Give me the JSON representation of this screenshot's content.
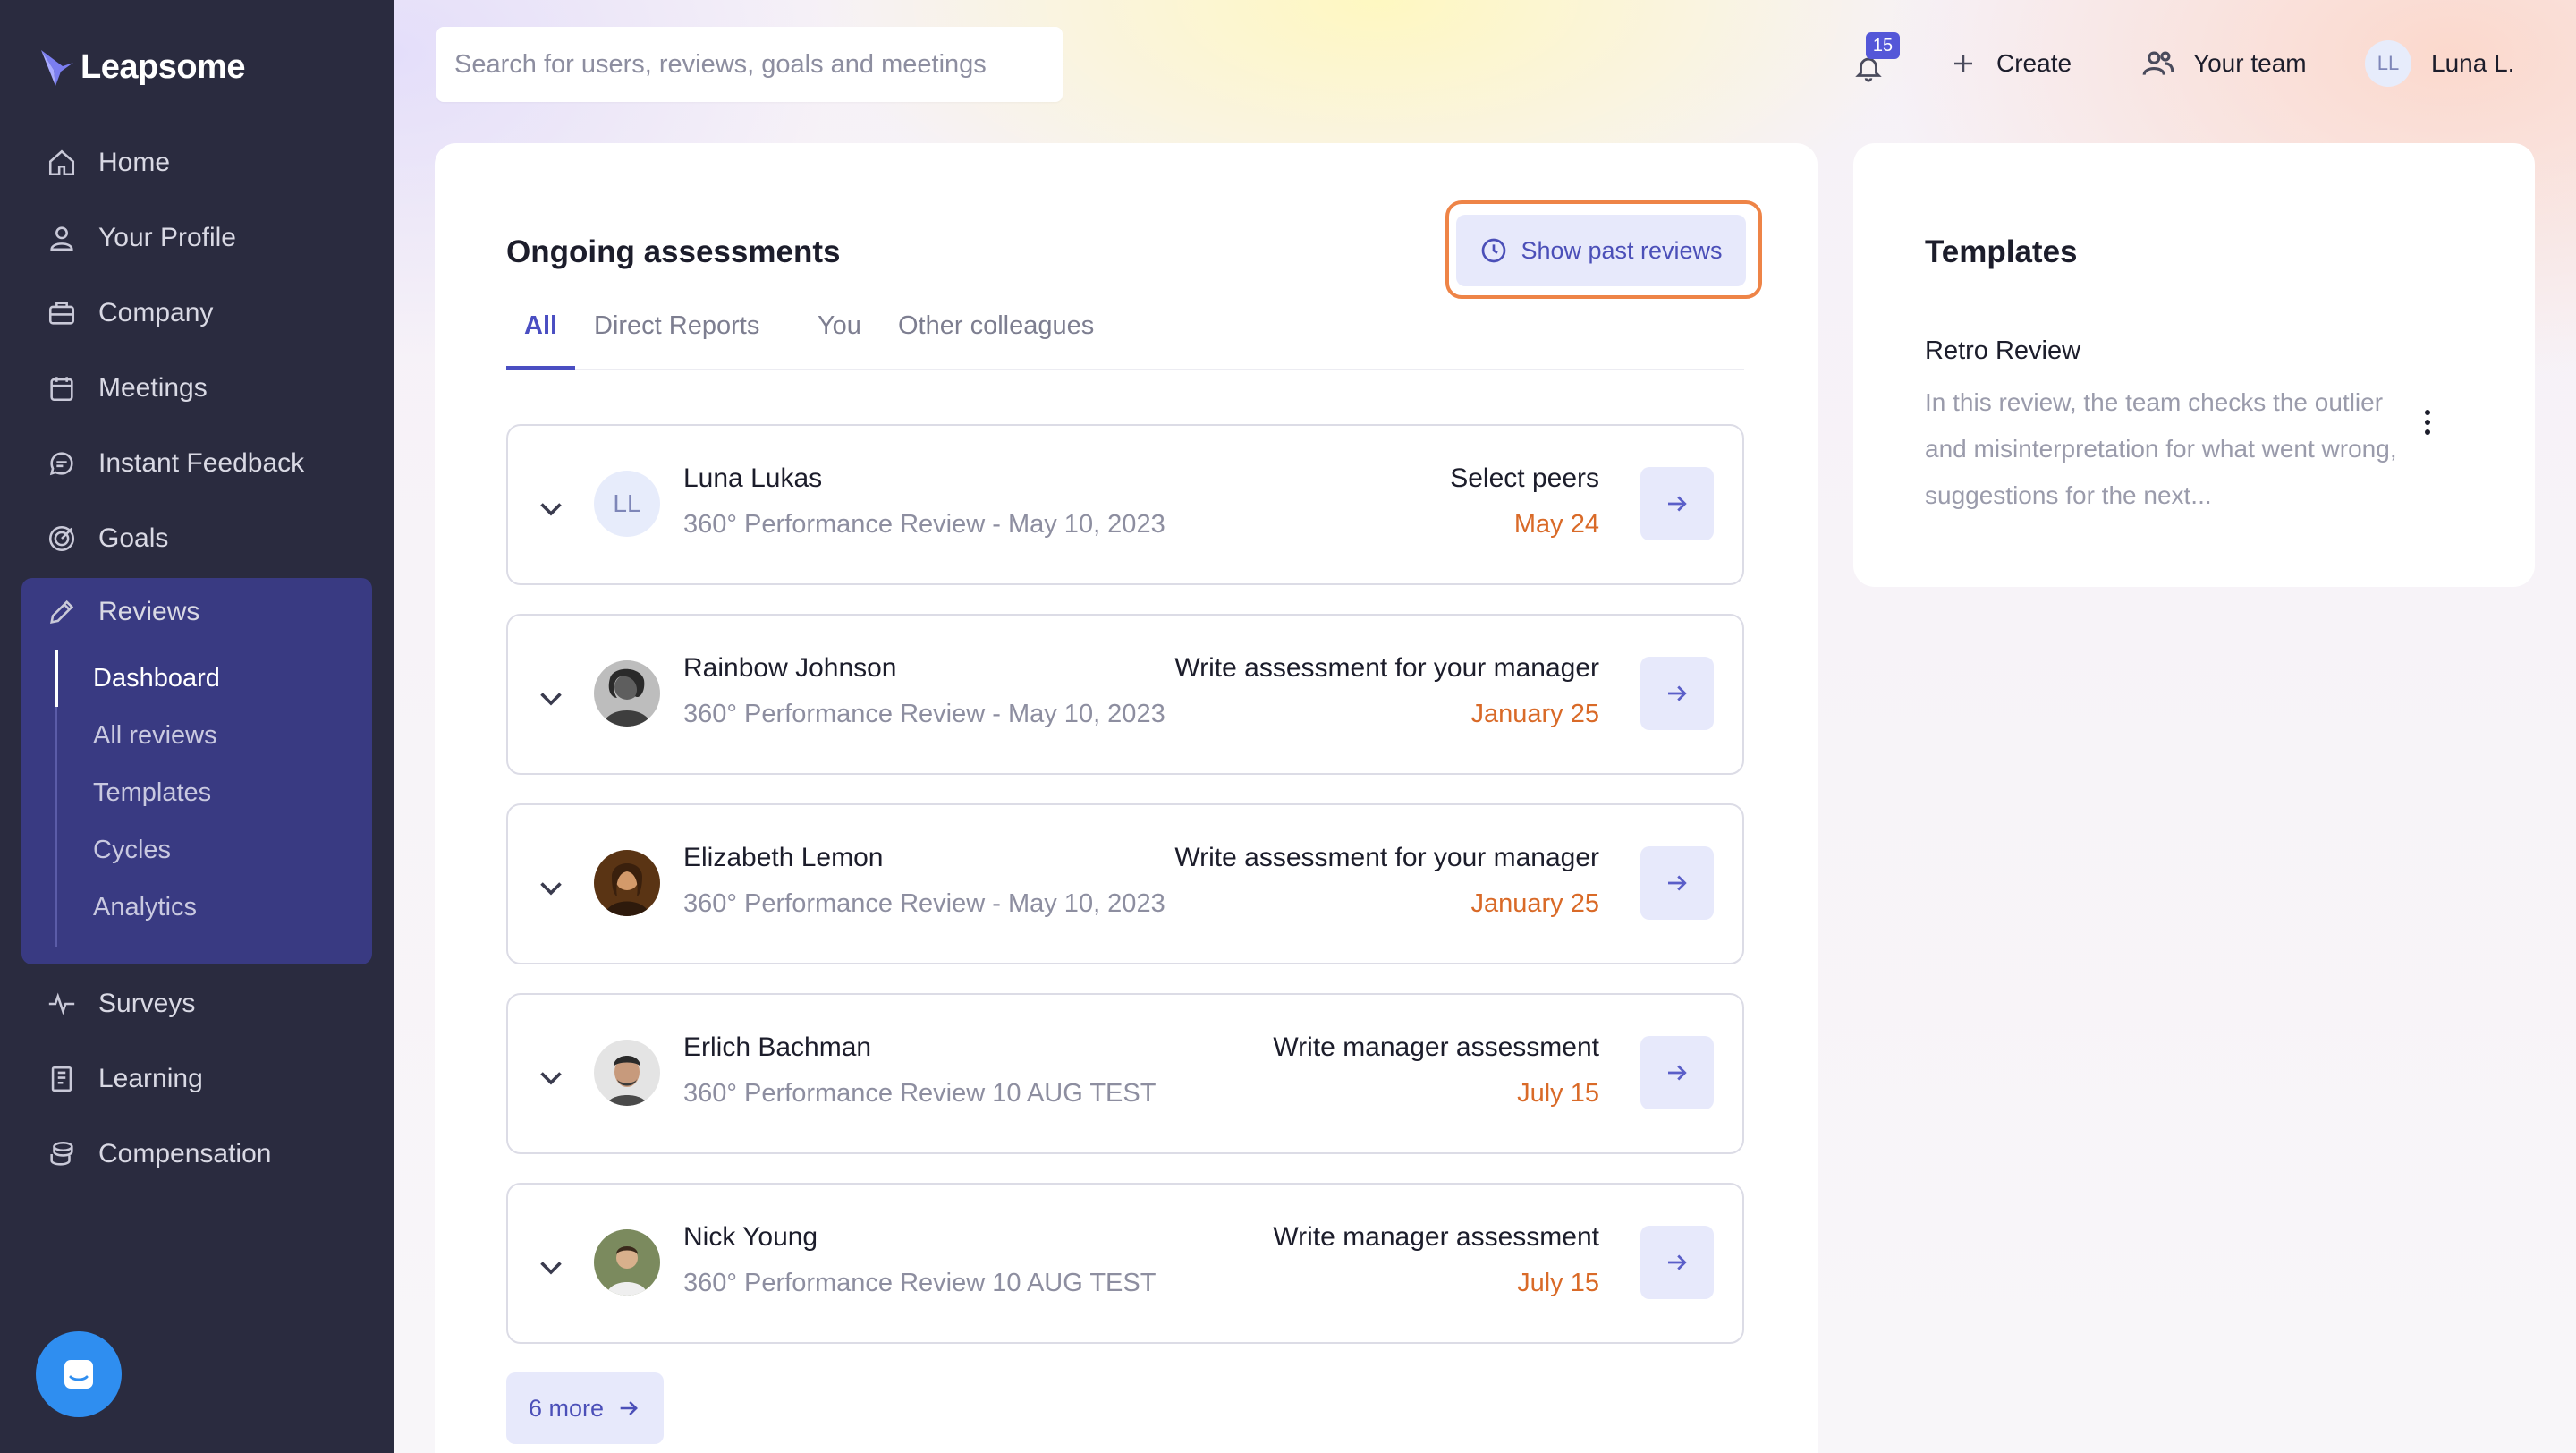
{
  "app": {
    "logo": "Leapsome"
  },
  "sidebar": {
    "items": [
      {
        "label": "Home",
        "icon": "home-icon"
      },
      {
        "label": "Your Profile",
        "icon": "user-icon"
      },
      {
        "label": "Company",
        "icon": "briefcase-icon"
      },
      {
        "label": "Meetings",
        "icon": "calendar-icon"
      },
      {
        "label": "Instant Feedback",
        "icon": "chat-icon"
      },
      {
        "label": "Goals",
        "icon": "target-icon"
      },
      {
        "label": "Reviews",
        "icon": "pencil-icon"
      },
      {
        "label": "Surveys",
        "icon": "pulse-icon"
      },
      {
        "label": "Learning",
        "icon": "book-icon"
      },
      {
        "label": "Compensation",
        "icon": "coins-icon"
      }
    ],
    "reviews_sub": [
      {
        "label": "Dashboard",
        "active": true
      },
      {
        "label": "All reviews"
      },
      {
        "label": "Templates"
      },
      {
        "label": "Cycles"
      },
      {
        "label": "Analytics"
      }
    ]
  },
  "topbar": {
    "search_placeholder": "Search for users, reviews, goals and meetings",
    "notifications_count": "15",
    "create_label": "Create",
    "your_team_label": "Your team",
    "user_initials": "LL",
    "user_name": "Luna L."
  },
  "assessments": {
    "title": "Ongoing assessments",
    "past_reviews_label": "Show past reviews",
    "tabs": [
      {
        "label": "All",
        "active": true
      },
      {
        "label": "Direct Reports"
      },
      {
        "label": "You"
      },
      {
        "label": "Other colleagues"
      }
    ],
    "rows": [
      {
        "name": "Luna Lukas",
        "initials": "LL",
        "subtitle": "360° Performance Review - May 10, 2023",
        "action": "Select peers",
        "due": "May 24"
      },
      {
        "name": "Rainbow Johnson",
        "subtitle": "360° Performance Review - May 10, 2023",
        "action": "Write assessment for your manager",
        "due": "January 25"
      },
      {
        "name": "Elizabeth Lemon",
        "subtitle": "360° Performance Review - May 10, 2023",
        "action": "Write assessment for your manager",
        "due": "January 25"
      },
      {
        "name": "Erlich Bachman",
        "subtitle": "360° Performance Review 10 AUG TEST",
        "action": "Write manager assessment",
        "due": "July 15"
      },
      {
        "name": "Nick Young",
        "subtitle": "360° Performance Review 10 AUG TEST",
        "action": "Write manager assessment",
        "due": "July 15"
      }
    ],
    "more_label": "6 more"
  },
  "templates": {
    "title": "Templates",
    "items": [
      {
        "name": "Retro Review",
        "description": "In this review, the team checks the outlier and misinterpretation for what went wrong, suggestions for the next..."
      }
    ]
  },
  "colors": {
    "sidebar_bg": "#2a2b3f",
    "sidebar_active_bg": "#393a82",
    "accent": "#4a4ec2",
    "due_date": "#d96a28",
    "highlight_outline": "#ee8447"
  }
}
